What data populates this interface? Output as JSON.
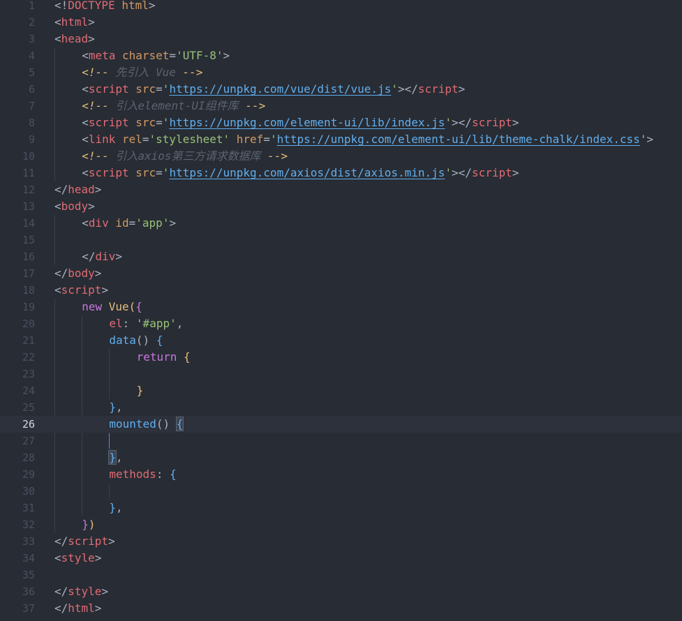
{
  "editor": {
    "current_line": 26,
    "lines": [
      {
        "n": "1",
        "indent": 0,
        "tokens": [
          [
            "<!",
            "t-punct"
          ],
          [
            "DOCTYPE",
            "t-tag"
          ],
          [
            " html",
            "t-attr"
          ],
          [
            ">",
            "t-punct"
          ]
        ]
      },
      {
        "n": "2",
        "indent": 0,
        "tokens": [
          [
            "<",
            "t-punct"
          ],
          [
            "html",
            "t-tag"
          ],
          [
            ">",
            "t-punct"
          ]
        ]
      },
      {
        "n": "3",
        "indent": 0,
        "tokens": [
          [
            "<",
            "t-punct"
          ],
          [
            "head",
            "t-tag"
          ],
          [
            ">",
            "t-punct"
          ]
        ]
      },
      {
        "n": "4",
        "indent": 4,
        "tokens": [
          [
            "<",
            "t-punct"
          ],
          [
            "meta",
            "t-tag"
          ],
          [
            " charset",
            "t-attr"
          ],
          [
            "=",
            "t-punct"
          ],
          [
            "'UTF-8'",
            "t-str"
          ],
          [
            ">",
            "t-punct"
          ]
        ]
      },
      {
        "n": "5",
        "indent": 4,
        "tokens": [
          [
            "<!--",
            "t-cmtmark"
          ],
          [
            " 先引入 Vue ",
            "t-cmt"
          ],
          [
            "-->",
            "t-cmtmark"
          ]
        ]
      },
      {
        "n": "6",
        "indent": 4,
        "tokens": [
          [
            "<",
            "t-punct"
          ],
          [
            "script",
            "t-tag"
          ],
          [
            " src",
            "t-attr"
          ],
          [
            "=",
            "t-punct"
          ],
          [
            "'",
            "t-str"
          ],
          [
            "https://unpkg.com/vue/dist/vue.js",
            "t-url"
          ],
          [
            "'",
            "t-str"
          ],
          [
            "></",
            "t-punct"
          ],
          [
            "script",
            "t-tag"
          ],
          [
            ">",
            "t-punct"
          ]
        ]
      },
      {
        "n": "7",
        "indent": 4,
        "tokens": [
          [
            "<!--",
            "t-cmtmark"
          ],
          [
            " 引入element-UI组件库 ",
            "t-cmt"
          ],
          [
            "-->",
            "t-cmtmark"
          ]
        ]
      },
      {
        "n": "8",
        "indent": 4,
        "tokens": [
          [
            "<",
            "t-punct"
          ],
          [
            "script",
            "t-tag"
          ],
          [
            " src",
            "t-attr"
          ],
          [
            "=",
            "t-punct"
          ],
          [
            "'",
            "t-str"
          ],
          [
            "https://unpkg.com/element-ui/lib/index.js",
            "t-url"
          ],
          [
            "'",
            "t-str"
          ],
          [
            "></",
            "t-punct"
          ],
          [
            "script",
            "t-tag"
          ],
          [
            ">",
            "t-punct"
          ]
        ]
      },
      {
        "n": "9",
        "indent": 4,
        "tokens": [
          [
            "<",
            "t-punct"
          ],
          [
            "link",
            "t-tag"
          ],
          [
            " rel",
            "t-attr"
          ],
          [
            "=",
            "t-punct"
          ],
          [
            "'stylesheet'",
            "t-str"
          ],
          [
            " href",
            "t-attr"
          ],
          [
            "=",
            "t-punct"
          ],
          [
            "'",
            "t-str"
          ],
          [
            "https://unpkg.com/element-ui/lib/theme-chalk/index.css",
            "t-url"
          ],
          [
            "'",
            "t-str"
          ],
          [
            ">",
            "t-punct"
          ]
        ]
      },
      {
        "n": "10",
        "indent": 4,
        "tokens": [
          [
            "<!--",
            "t-cmtmark"
          ],
          [
            " 引入axios第三方请求数据库 ",
            "t-cmt"
          ],
          [
            "-->",
            "t-cmtmark"
          ]
        ]
      },
      {
        "n": "11",
        "indent": 4,
        "tokens": [
          [
            "<",
            "t-punct"
          ],
          [
            "script",
            "t-tag"
          ],
          [
            " src",
            "t-attr"
          ],
          [
            "=",
            "t-punct"
          ],
          [
            "'",
            "t-str"
          ],
          [
            "https://unpkg.com/axios/dist/axios.min.js",
            "t-url"
          ],
          [
            "'",
            "t-str"
          ],
          [
            "></",
            "t-punct"
          ],
          [
            "script",
            "t-tag"
          ],
          [
            ">",
            "t-punct"
          ]
        ]
      },
      {
        "n": "12",
        "indent": 0,
        "tokens": [
          [
            "</",
            "t-punct"
          ],
          [
            "head",
            "t-tag"
          ],
          [
            ">",
            "t-punct"
          ]
        ]
      },
      {
        "n": "13",
        "indent": 0,
        "tokens": [
          [
            "<",
            "t-punct"
          ],
          [
            "body",
            "t-tag"
          ],
          [
            ">",
            "t-punct"
          ]
        ]
      },
      {
        "n": "14",
        "indent": 4,
        "tokens": [
          [
            "<",
            "t-punct"
          ],
          [
            "div",
            "t-tag"
          ],
          [
            " id",
            "t-attr"
          ],
          [
            "=",
            "t-punct"
          ],
          [
            "'app'",
            "t-str"
          ],
          [
            ">",
            "t-punct"
          ]
        ]
      },
      {
        "n": "15",
        "indent": 0,
        "tokens": []
      },
      {
        "n": "16",
        "indent": 4,
        "tokens": [
          [
            "</",
            "t-punct"
          ],
          [
            "div",
            "t-tag"
          ],
          [
            ">",
            "t-punct"
          ]
        ]
      },
      {
        "n": "17",
        "indent": 0,
        "tokens": [
          [
            "</",
            "t-punct"
          ],
          [
            "body",
            "t-tag"
          ],
          [
            ">",
            "t-punct"
          ]
        ]
      },
      {
        "n": "18",
        "indent": 0,
        "tokens": [
          [
            "<",
            "t-punct"
          ],
          [
            "script",
            "t-tag"
          ],
          [
            ">",
            "t-punct"
          ]
        ]
      },
      {
        "n": "19",
        "indent": 4,
        "tokens": [
          [
            "new",
            "t-kw"
          ],
          [
            " ",
            "t-punct"
          ],
          [
            "Vue",
            "t-br1"
          ],
          [
            "(",
            "t-br1"
          ],
          [
            "{",
            "t-br2"
          ]
        ]
      },
      {
        "n": "20",
        "indent": 8,
        "tokens": [
          [
            "el",
            "t-prop"
          ],
          [
            ": ",
            "t-punct"
          ],
          [
            "'#app'",
            "t-str"
          ],
          [
            ",",
            "t-punct"
          ]
        ]
      },
      {
        "n": "21",
        "indent": 8,
        "tokens": [
          [
            "data",
            "t-fn"
          ],
          [
            "() ",
            "t-punct"
          ],
          [
            "{",
            "t-br3"
          ]
        ]
      },
      {
        "n": "22",
        "indent": 12,
        "tokens": [
          [
            "return",
            "t-kw"
          ],
          [
            " ",
            "t-punct"
          ],
          [
            "{",
            "t-br1"
          ]
        ]
      },
      {
        "n": "23",
        "indent": 0,
        "tokens": []
      },
      {
        "n": "24",
        "indent": 12,
        "tokens": [
          [
            "}",
            "t-br1"
          ]
        ]
      },
      {
        "n": "25",
        "indent": 8,
        "tokens": [
          [
            "}",
            "t-br3"
          ],
          [
            ",",
            "t-punct"
          ]
        ]
      },
      {
        "n": "26",
        "indent": 8,
        "tokens": [
          [
            "mounted",
            "t-fn"
          ],
          [
            "() ",
            "t-punct"
          ],
          [
            "{",
            "t-br3 brace-hl"
          ]
        ]
      },
      {
        "n": "27",
        "indent": 0,
        "tokens": []
      },
      {
        "n": "28",
        "indent": 8,
        "tokens": [
          [
            "}",
            "t-br3 brace-hl"
          ],
          [
            ",",
            "t-punct"
          ]
        ]
      },
      {
        "n": "29",
        "indent": 8,
        "tokens": [
          [
            "methods",
            "t-prop"
          ],
          [
            ": ",
            "t-punct"
          ],
          [
            "{",
            "t-br3"
          ]
        ]
      },
      {
        "n": "30",
        "indent": 0,
        "tokens": []
      },
      {
        "n": "31",
        "indent": 8,
        "tokens": [
          [
            "}",
            "t-br3"
          ],
          [
            ",",
            "t-punct"
          ]
        ]
      },
      {
        "n": "32",
        "indent": 4,
        "tokens": [
          [
            "}",
            "t-br2"
          ],
          [
            ")",
            "t-br1"
          ]
        ]
      },
      {
        "n": "33",
        "indent": 0,
        "tokens": [
          [
            "</",
            "t-punct"
          ],
          [
            "script",
            "t-tag"
          ],
          [
            ">",
            "t-punct"
          ]
        ]
      },
      {
        "n": "34",
        "indent": 0,
        "tokens": [
          [
            "<",
            "t-punct"
          ],
          [
            "style",
            "t-tag"
          ],
          [
            ">",
            "t-punct"
          ]
        ]
      },
      {
        "n": "35",
        "indent": 0,
        "tokens": []
      },
      {
        "n": "36",
        "indent": 0,
        "tokens": [
          [
            "</",
            "t-punct"
          ],
          [
            "style",
            "t-tag"
          ],
          [
            ">",
            "t-punct"
          ]
        ]
      },
      {
        "n": "37",
        "indent": 0,
        "tokens": [
          [
            "</",
            "t-punct"
          ],
          [
            "html",
            "t-tag"
          ],
          [
            ">",
            "t-punct"
          ]
        ]
      }
    ]
  }
}
